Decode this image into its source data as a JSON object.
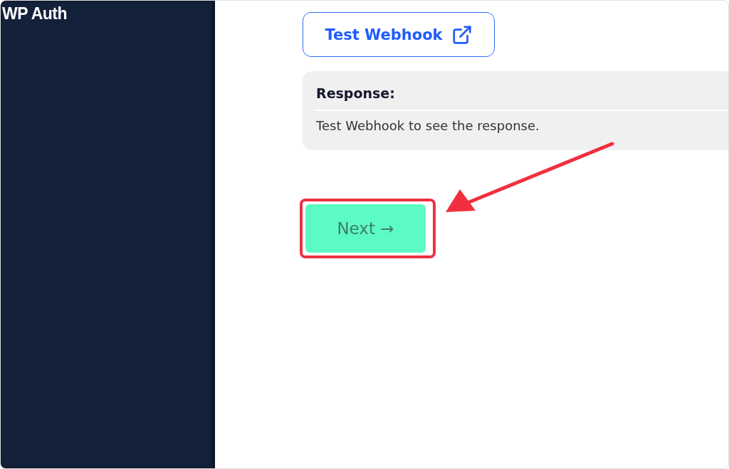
{
  "sidebar": {
    "title": "WP Auth"
  },
  "test_button": {
    "label": "Test Webhook"
  },
  "response": {
    "heading": "Response:",
    "text": "Test Webhook to see the response."
  },
  "next_button": {
    "label": "Next →",
    "highlighted": true
  },
  "annotation": {
    "arrow": true
  }
}
